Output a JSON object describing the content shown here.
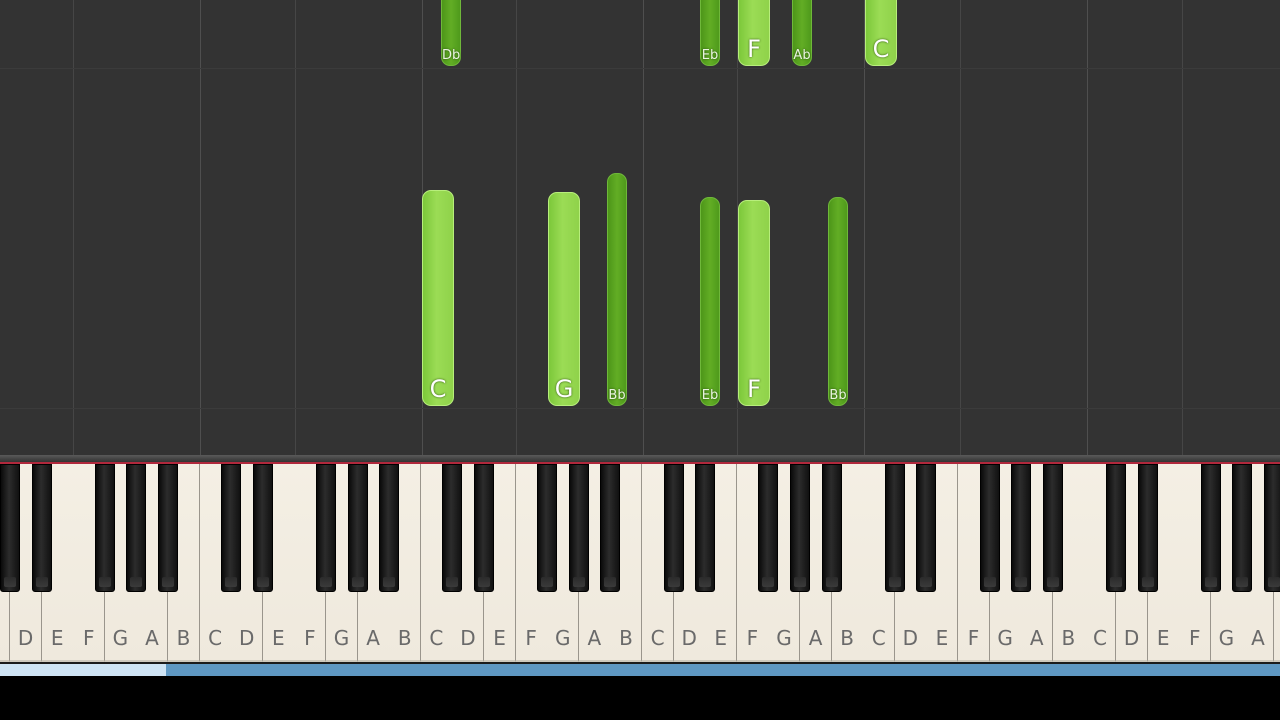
{
  "app": {
    "name": "Synthesia piano roll"
  },
  "keyboard": {
    "first_white_note": "D",
    "white_key_count": 41,
    "note_cycle": [
      "C",
      "D",
      "E",
      "F",
      "G",
      "A",
      "B"
    ]
  },
  "upper_notes": [
    {
      "label": "Db",
      "kind": "black"
    },
    {
      "label": "Eb",
      "kind": "black"
    },
    {
      "label": "F",
      "kind": "white"
    },
    {
      "label": "Ab",
      "kind": "black"
    },
    {
      "label": "C",
      "kind": "white"
    }
  ],
  "lower_notes": [
    {
      "label": "C",
      "kind": "white"
    },
    {
      "label": "G",
      "kind": "white"
    },
    {
      "label": "Bb",
      "kind": "black"
    },
    {
      "label": "Eb",
      "kind": "black"
    },
    {
      "label": "F",
      "kind": "white"
    },
    {
      "label": "Bb",
      "kind": "black"
    }
  ],
  "progress": {
    "fraction": 0.13
  },
  "colors": {
    "roll_background": "#333333",
    "white_note": "#8fd24a",
    "black_note": "#5aa520",
    "progress_bar": "#5f98c3",
    "cursor_line": "#b0283c"
  }
}
